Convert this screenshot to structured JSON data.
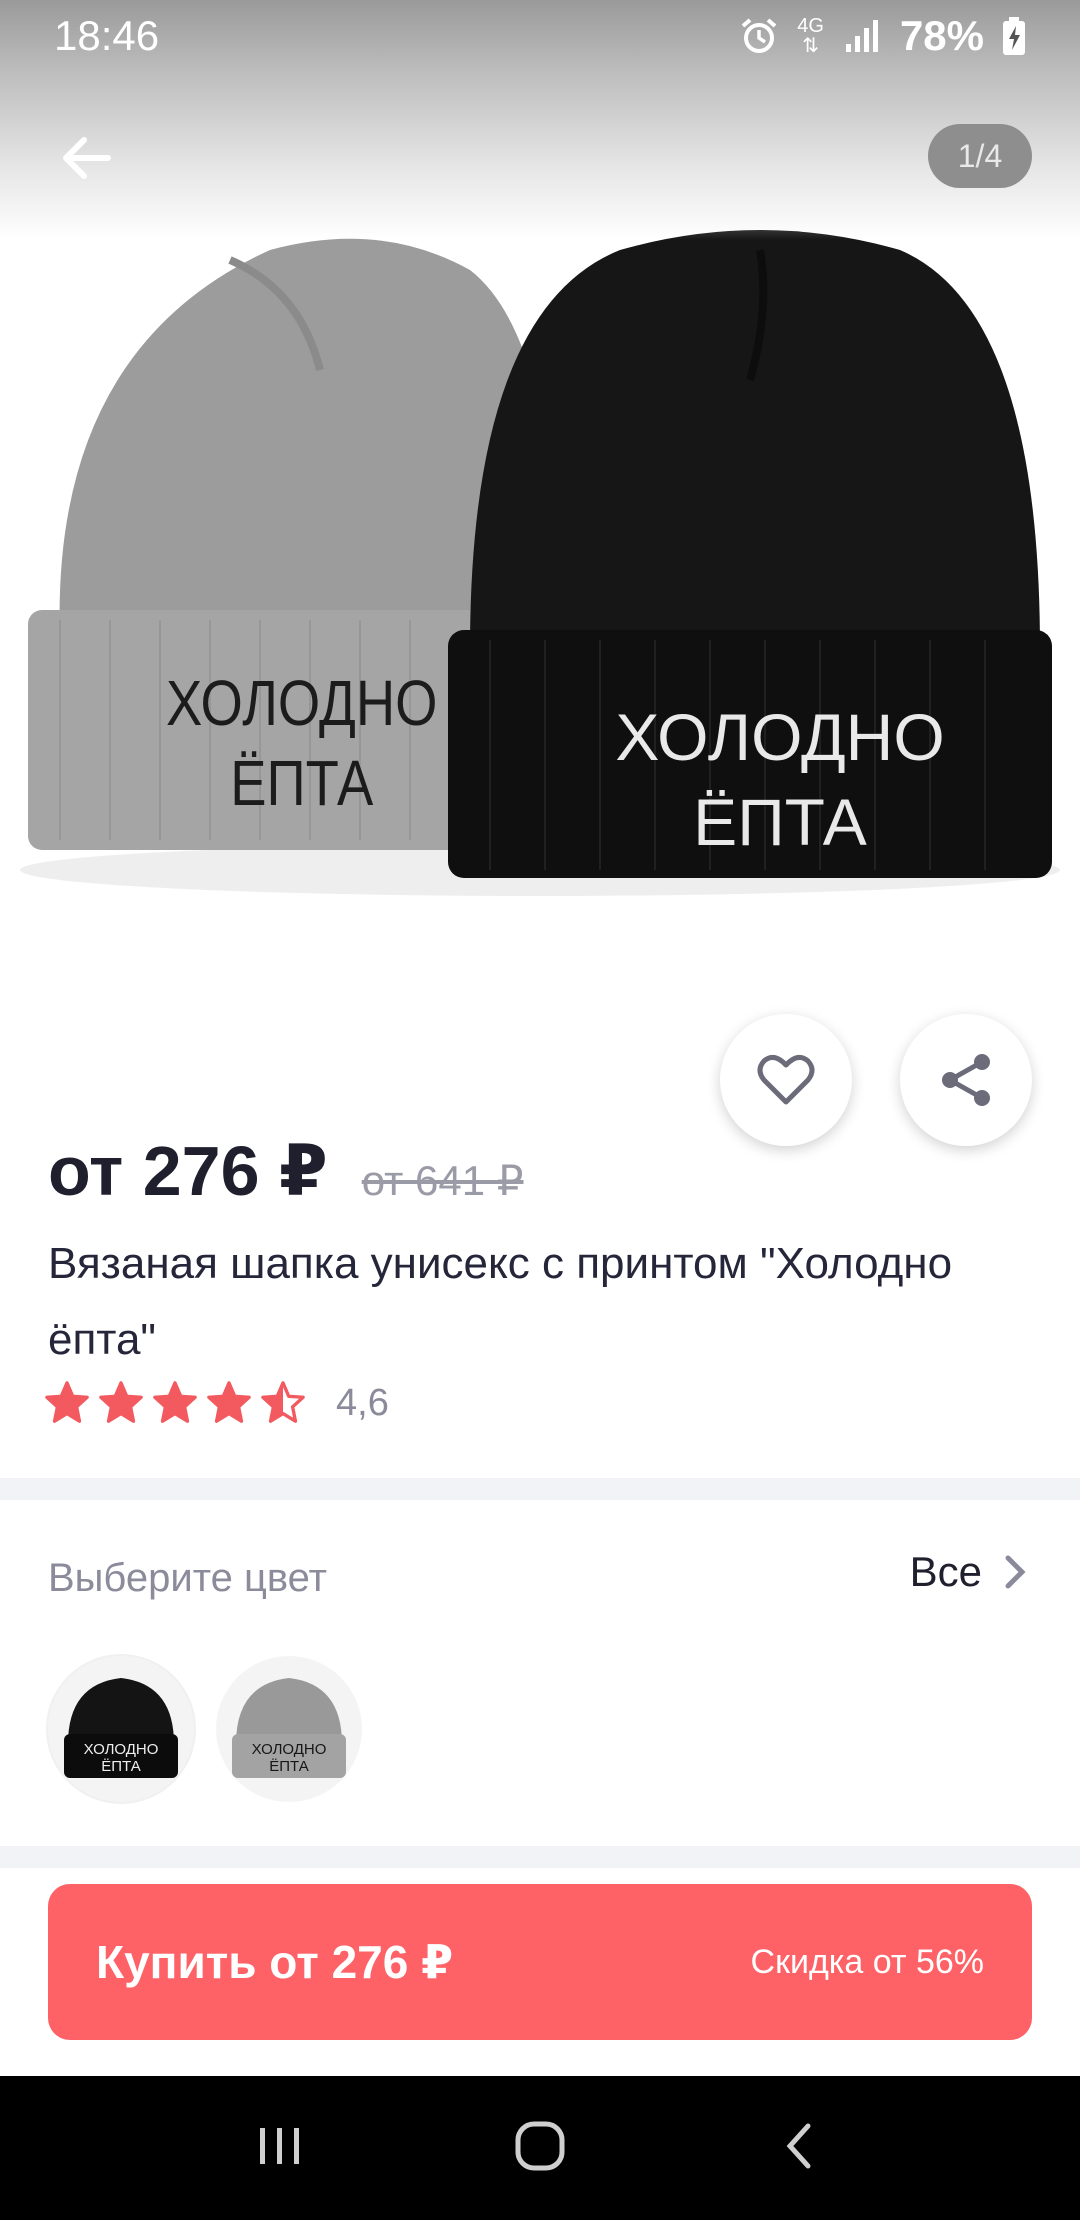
{
  "status_bar": {
    "time": "18:46",
    "network_top": "4G",
    "battery": "78%",
    "icons": [
      "alarm-icon",
      "network-4g-icon",
      "signal-icon",
      "battery-charging-icon"
    ]
  },
  "header": {
    "back_icon": "arrow-left-icon",
    "pager": "1/4"
  },
  "product_image": {
    "beanie_text_line1": "ХОЛОДНО",
    "beanie_text_line2": "ЁПТА"
  },
  "actions": {
    "favorite_icon": "heart-icon",
    "share_icon": "share-icon"
  },
  "product": {
    "price": "от 276 ₽",
    "old_price": "от 641 ₽",
    "title": "Вязаная шапка унисекс с принтом \"Холодно ёпта\"",
    "rating": {
      "value": "4,6",
      "stars": 4.6,
      "max": 5,
      "color": "#f25a5f"
    }
  },
  "color_picker": {
    "label": "Выберите цвет",
    "all_label": "Все",
    "options": [
      {
        "name": "black",
        "color": "#101010",
        "text_color": "#ffffff"
      },
      {
        "name": "gray",
        "color": "#9a9a9a",
        "text_color": "#111111"
      }
    ]
  },
  "buy_button": {
    "label": "Купить от 276 ₽",
    "discount": "Скидка от 56%",
    "color": "#fe6267"
  },
  "nav_bar": {
    "icons": [
      "recent-apps-icon",
      "home-icon",
      "back-icon"
    ]
  }
}
